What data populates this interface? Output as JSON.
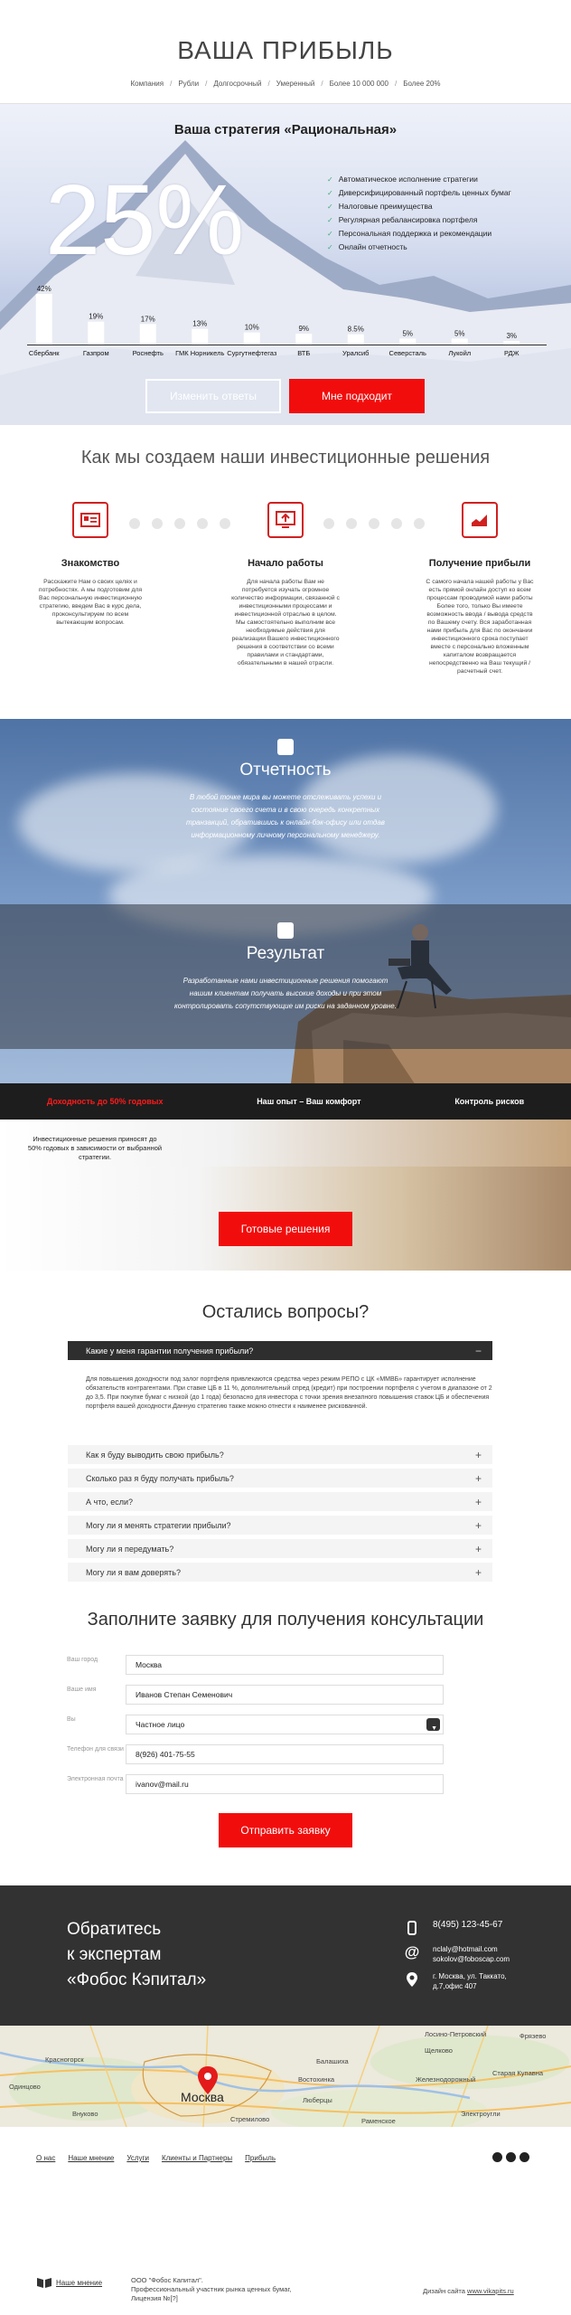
{
  "header": {
    "title": "ВАША ПРИБЫЛЬ",
    "nav": [
      "Компания",
      "Рубли",
      "Долгосрочный",
      "Умеренный",
      "Более 10 000 000",
      "Более 20%"
    ]
  },
  "hero": {
    "strategy_title": "Ваша стратегия «Рациональная»",
    "big_number": "25%",
    "features": [
      "Автоматическое исполнение стратегии",
      "Диверсифицированный портфель ценных бумаг",
      "Налоговые преимущества",
      "Регулярная ребалансировка портфеля",
      "Персональная поддержка и рекомендации",
      "Онлайн отчетность"
    ],
    "btn_change": "Изменить ответы",
    "btn_ok": "Мне подходит"
  },
  "chart_data": {
    "type": "bar",
    "categories": [
      "Сбербанк",
      "Газпром",
      "Роснефть",
      "ГМК Норникель",
      "Сургутнефтегаз",
      "ВТБ",
      "Уралсиб",
      "Северсталь",
      "Лукойл",
      "РДЖ"
    ],
    "values": [
      42,
      19,
      17,
      13,
      10,
      9,
      8.5,
      5,
      5,
      3
    ],
    "value_labels": [
      "42%",
      "19%",
      "17%",
      "13%",
      "10%",
      "9%",
      "8.5%",
      "5%",
      "5%",
      "3%"
    ],
    "ylim": [
      0,
      45
    ]
  },
  "how": {
    "title": "Как мы создаем наши инвестиционные решения",
    "steps": [
      {
        "title": "Знакомство",
        "text": "Расскажите Нам о своих целях и потребностях. А мы подготовим для Вас персональную инвестиционную стратегию, введем Вас в курс дела, проконсультируем по всем вытекающим вопросам."
      },
      {
        "title": "Начало работы",
        "text": "Для начала работы Вам не потребуется изучать огромное количество информации, связанной с инвестиционными процессами и инвестиционной отраслью в целом. Мы самостоятельно выполним все необходимые действия для реализации Вашего инвестиционного решения в соответствии со всеми правилами и стандартами, обязательными в нашей отрасли."
      },
      {
        "title": "Получение прибыли",
        "text": "С самого начала нашей работы у Вас есть прямой онлайн доступ ко всем процессам проводимой нами работы Более того, только Вы имеете возможность ввода / вывода средств по Вашему счету. Вся заработанная нами прибыль для Вас по окончании инвестиционного срока поступает вместе с персонально вложенным капиталом возвращается непосредственно на Ваш текущий / расчетный счет."
      }
    ]
  },
  "band": {
    "report_title": "Отчетность",
    "report_text": "В любой точке мира вы можете отслеживать успехи и состояние своего счета и в свою очередь конкретных транзакций, обратившись к онлайн-бэк-офису или отдав информационному личному персональному менеджеру.",
    "result_title": "Результат",
    "result_text": "Разработанные нами инвестиционные решения помогают нашим клиентам получать высокие доходы и при этом контролировать сопутствующие им риски на заданном уровне.",
    "tabs": [
      "Доходность до 50% годовых",
      "Наш опыт – Ваш комфорт",
      "Контроль рисков"
    ],
    "tab_desc": "Инвестиционные решения приносят до 50% годовых в зависимости от выбранной стратегии."
  },
  "ready_btn": "Готовые решения",
  "faq": {
    "title": "Остались вопросы?",
    "open_question": "Какие у меня гарантии получения прибыли?",
    "answer": "Для повышения доходности под залог портфеля привлекаются средства через режим РЕПО с ЦК «ММВБ» гарантирует исполнение обязательств контрагентами. При ставке ЦБ в 11 %, дополнительный спред (кредит) при построении портфеля с учетом в диапазоне от 2 до 3,5. При покупке бумаг с низкой (до 1 года) безопасно для инвестора с точки зрения внезапного повышения ставок ЦБ и обеспечения портфеля вашей доходности.Данную стратегию также можно отнести к наименее рискованной.",
    "questions": [
      "Как я буду выводить свою прибыль?",
      "Сколько раз я буду получать прибыль?",
      "А что, если?",
      "Могу ли я менять стратегии прибыли?",
      "Могу ли я передумать?",
      "Могу ли я вам доверять?"
    ]
  },
  "form": {
    "title": "Заполните заявку для получения консультации",
    "fields": [
      {
        "label": "Ваш город",
        "value": "Москва"
      },
      {
        "label": "Ваше имя",
        "value": "Иванов Степан Семенович"
      },
      {
        "label": "Вы",
        "value": "Частное лицо"
      },
      {
        "label": "Телефон для связи",
        "value": "8(926) 401-75-55"
      },
      {
        "label": "Электронная почта",
        "value": "ivanov@mail.ru"
      }
    ],
    "submit": "Отправить заявку"
  },
  "contacts": {
    "title_lines": [
      "Обратитесь",
      "к экспертам",
      "«Фобос Кэпитал»"
    ],
    "phone": "8(495) 123-45-67",
    "email1": "nclaly@hotmail.com",
    "email2": "sokolov@foboscap.com",
    "address1": "г. Москва, ул. Таккато,",
    "address2": "д.7,офис 407"
  },
  "map": {
    "city": "Москва",
    "labels": [
      "Лосино-Петровский",
      "Щелково",
      "Фрязево",
      "Старая Купавна",
      "Красногорск",
      "Балашиха",
      "Железнодорожный",
      "Востохинка",
      "Одинцово",
      "Люберцы",
      "Электроугли",
      "Раменское",
      "Внуково",
      "Стремилово"
    ]
  },
  "footer": {
    "links": [
      "О нас",
      "Наше мнение",
      "Услуги",
      "Клиенты и Партнеры",
      "Прибыль"
    ],
    "logo_text": "Наше мнение",
    "legal1": "ООО \"Фобос Капитал\".",
    "legal2": "Профессиональный участник рынка ценных бумаг,",
    "legal3": "Лицензия №[?]",
    "dev_prefix": "Дизайн сайта",
    "dev_link": "www.vikapits.ru"
  },
  "colors": {
    "accent": "#f20d0d",
    "dark": "#323232"
  }
}
